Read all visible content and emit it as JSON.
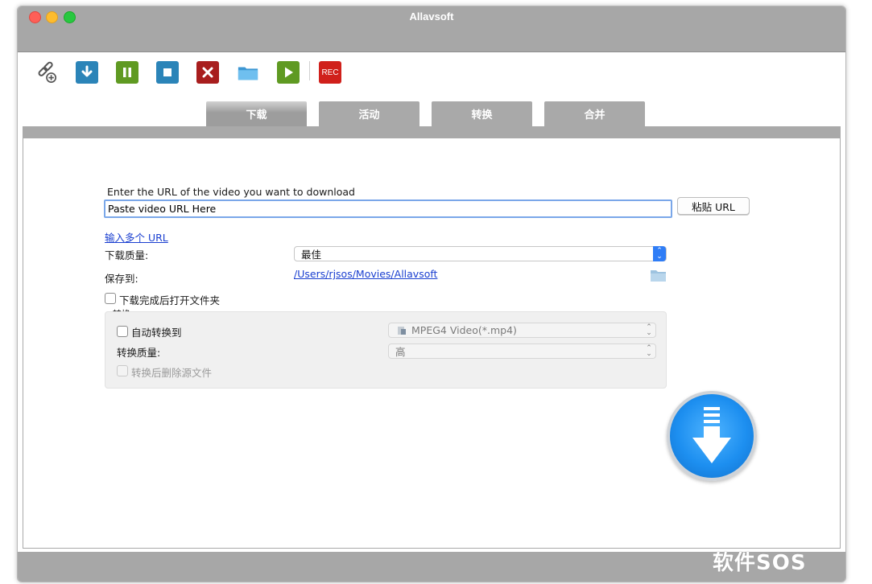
{
  "window": {
    "title": "Allavsoft"
  },
  "toolbar": {
    "buttons": [
      {
        "icon": "add-link-icon"
      },
      {
        "icon": "download-icon"
      },
      {
        "icon": "pause-icon"
      },
      {
        "icon": "stop-icon"
      },
      {
        "icon": "delete-icon"
      },
      {
        "icon": "folder-icon"
      },
      {
        "icon": "play-icon"
      },
      {
        "icon": "record-icon",
        "label": "REC"
      }
    ]
  },
  "tabs": [
    {
      "label": "下载",
      "active": true
    },
    {
      "label": "活动",
      "active": false
    },
    {
      "label": "转换",
      "active": false
    },
    {
      "label": "合并",
      "active": false
    }
  ],
  "download": {
    "prompt": "Enter the URL of the video you want to download",
    "url_value": "Paste video URL Here",
    "paste_button": "粘贴 URL",
    "multi_url_link": "输入多个 URL",
    "quality_label": "下载质量:",
    "quality_value": "最佳",
    "save_to_label": "保存到:",
    "save_path": "/Users/rjsos/Movies/Allavsoft",
    "open_folder_label": "下载完成后打开文件夹",
    "open_folder_checked": false
  },
  "convert": {
    "section_label": "转换",
    "auto_convert_label": "自动转换到",
    "auto_convert_checked": false,
    "format_value": "MPEG4 Video(*.mp4)",
    "quality_label": "转换质量:",
    "quality_value": "高",
    "delete_source_label": "转换后删除源文件",
    "delete_source_checked": false
  },
  "watermark": {
    "text": "软件SOS"
  },
  "colors": {
    "accent": "#2f7df6",
    "link": "#1a3fd0",
    "chrome": "#a7a7a7",
    "rec": "#d0201b"
  }
}
